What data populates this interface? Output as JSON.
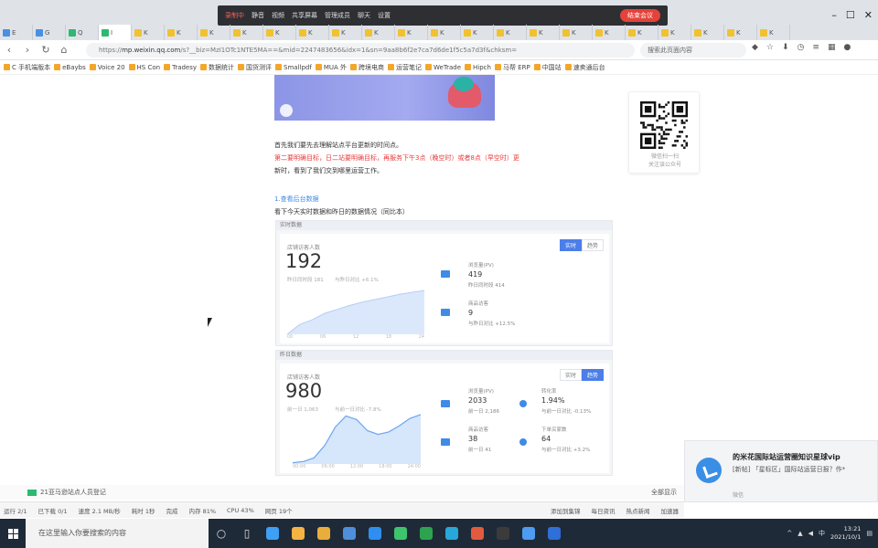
{
  "meeting": {
    "rec_label": "录制中",
    "items": [
      "静音",
      "视频",
      "共享屏幕",
      "管理成员",
      "聊天",
      "设置"
    ],
    "end_label": "结束会议"
  },
  "tabs": [
    {
      "label": "E",
      "color": "#4a90e2"
    },
    {
      "label": "G",
      "color": "#4a90e2"
    },
    {
      "label": "Q",
      "color": "#2eb872"
    },
    {
      "label": "I",
      "color": "#2eb872"
    },
    {
      "label": "K",
      "color": "#f2c12e"
    },
    {
      "label": "K",
      "color": "#f2c12e"
    },
    {
      "label": "K",
      "color": "#f2c12e"
    },
    {
      "label": "K",
      "color": "#f2c12e"
    },
    {
      "label": "K",
      "color": "#f2c12e"
    },
    {
      "label": "K",
      "color": "#f2c12e"
    },
    {
      "label": "K",
      "color": "#f2c12e"
    },
    {
      "label": "K",
      "color": "#f2c12e"
    },
    {
      "label": "K",
      "color": "#f2c12e"
    },
    {
      "label": "K",
      "color": "#f2c12e"
    },
    {
      "label": "K",
      "color": "#f2c12e"
    },
    {
      "label": "K",
      "color": "#f2c12e"
    },
    {
      "label": "K",
      "color": "#f2c12e"
    },
    {
      "label": "K",
      "color": "#f2c12e"
    },
    {
      "label": "K",
      "color": "#f2c12e"
    },
    {
      "label": "K",
      "color": "#f2c12e"
    },
    {
      "label": "K",
      "color": "#f2c12e"
    },
    {
      "label": "K",
      "color": "#f2c12e"
    },
    {
      "label": "K",
      "color": "#f2c12e"
    },
    {
      "label": "K",
      "color": "#f2c12e"
    }
  ],
  "address": {
    "url_prefix": "https://",
    "host": "mp.weixin.qq.com",
    "url_rest": "/s?__biz=MzI1OTc1NTE5MA==&mid=2247483656&idx=1&sn=9aa8b6f2e7ca7d6de1f5c5a7d3f&chksm=",
    "search_text": "搜索此页面内容"
  },
  "bookmarks": [
    "C 手机端版本",
    "eBaybs",
    "Voice 20",
    "HS Con",
    "Tradesy",
    "数据统计",
    "国货测评",
    "Smallpdf",
    "MUA 外",
    "跨境电商",
    "运营笔记",
    "WeTrade",
    "Hipch",
    "马帮 ERP",
    "中国站",
    "速卖通后台"
  ],
  "article": {
    "line1": "首先我们要先去理解站点平台更新的时间点。",
    "line2_red": "第二要明确目标，日二站要明确目标，再服务下午3点（晚空时）或者8点（早空时）更",
    "line3": "新时，看到了我们交到哪里运营工作。",
    "section_title": "1.查看后台数据",
    "section_desc": "看下今天实时数据和昨日的数据情况（同比本）"
  },
  "qr": {
    "caption1": "微信扫一扫",
    "caption2": "关注该公众号"
  },
  "dash1": {
    "header": "实时数据",
    "toggle_a": "实时",
    "toggle_b": "趋势",
    "label": "店铺访客人数",
    "big": "192",
    "sub1": "昨日同时段 181",
    "sub2": "与昨日对比 +6.1%",
    "stats": [
      {
        "label": "浏览量(PV)",
        "value": "419",
        "note": "昨日同时段 414"
      },
      {
        "label": "商品访客",
        "value": "9",
        "note": "与昨日对比 +12.5%"
      }
    ],
    "axis": [
      "00",
      "06",
      "12",
      "18",
      "24"
    ],
    "chart_points": [
      0,
      15,
      22,
      32,
      38,
      44,
      49,
      53,
      57,
      61,
      64,
      67
    ]
  },
  "dash2": {
    "header": "昨日数据",
    "toggle_a": "实时",
    "toggle_b": "趋势",
    "label": "店铺访客人数",
    "big": "980",
    "sub1": "前一日 1,063",
    "sub2": "与前一日对比 -7.8%",
    "stats": [
      {
        "label": "浏览量(PV)",
        "value": "2033",
        "note": "前一日 2,186"
      },
      {
        "label": "转化率",
        "value": "1.94%",
        "note": "与前一日对比 -0.13%"
      },
      {
        "label": "商品访客",
        "value": "38",
        "note": "前一日 41"
      },
      {
        "label": "下单买家数",
        "value": "64",
        "note": "与前一日对比 +3.2%"
      }
    ],
    "axis": [
      "00:00",
      "06:00",
      "12:00",
      "18:00",
      "24:00"
    ],
    "chart_points": [
      2,
      4,
      10,
      30,
      60,
      78,
      72,
      54,
      48,
      52,
      62,
      74,
      80
    ]
  },
  "notification": {
    "title": "的米花国际站运营圈知识星球vip",
    "body": "[新帖] 「星标区」国际站运营日报？作*",
    "source": "微信"
  },
  "downloads": {
    "file": "21亚马逊站点人员登记",
    "label": "全部显示"
  },
  "status": [
    "运行 2/1",
    "已下载 0/1",
    "速度 2.1 MB/秒",
    "耗时 1秒",
    "完成",
    "内存 81%",
    "CPU 43%",
    "网页 19个"
  ],
  "status_right": [
    "添加到集锦",
    "每日资讯",
    "热点新闻",
    "加速器"
  ],
  "taskbar": {
    "search_placeholder": "在这里输入你要搜索的内容",
    "apps": [
      "#3da0f5",
      "#f5b342",
      "#e9ad3b",
      "#4e8fd9",
      "#2f8ff0",
      "#3ec46d",
      "#2ea34f",
      "#27a8d8",
      "#e35b3f",
      "#3b3b3b",
      "#4e9bf2",
      "#2e6fd8"
    ],
    "time": "13:21",
    "date": "2021/10/1"
  }
}
